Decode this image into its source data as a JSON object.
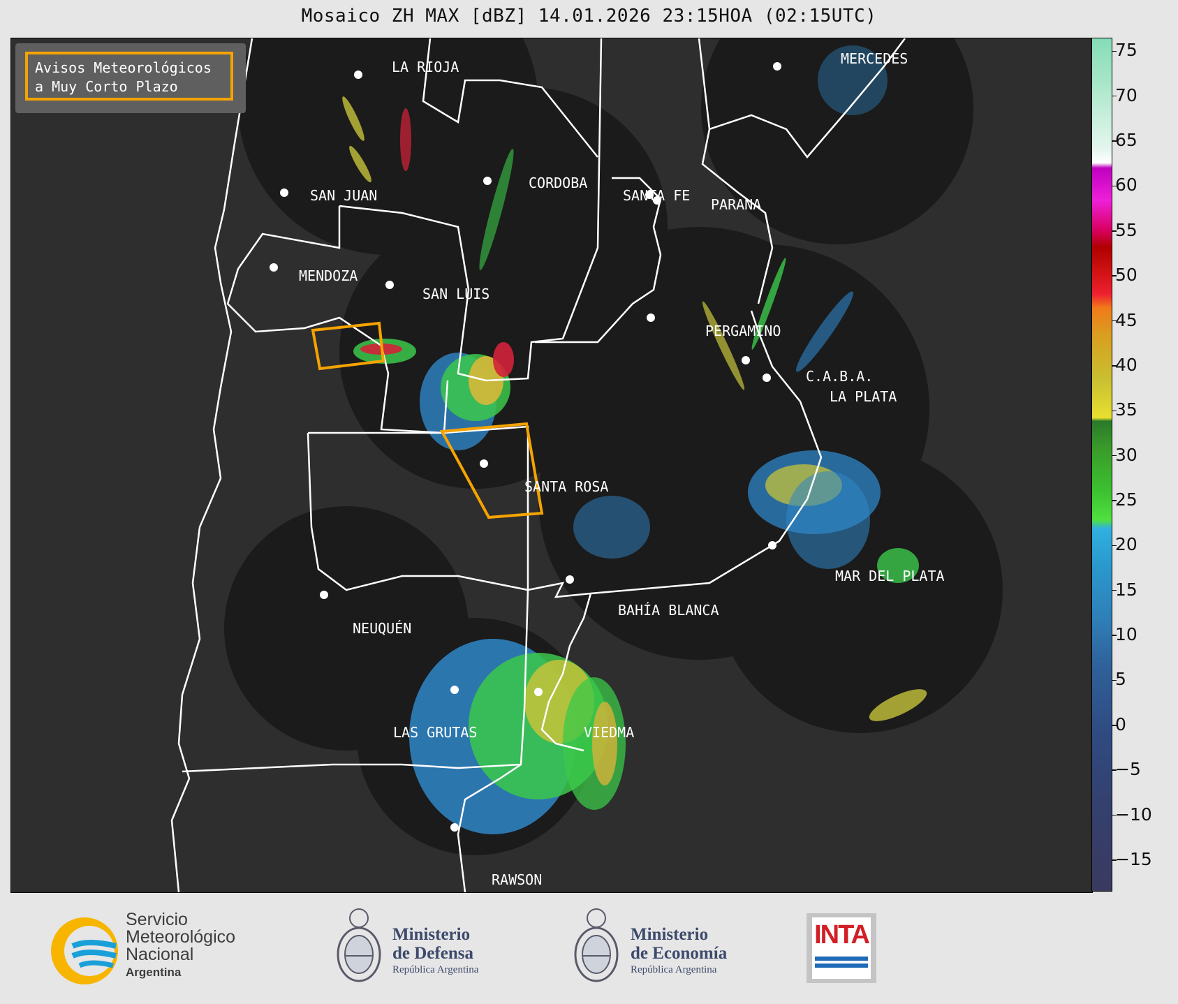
{
  "title": "Mosaico ZH MAX [dBZ] 14.01.2026 23:15HOA (02:15UTC)",
  "warning_box": {
    "line1": "Avisos Meteorológicos",
    "line2": "a Muy Corto Plazo",
    "color": "#f5a300"
  },
  "cities": [
    {
      "id": "la-rioja",
      "name": "LA RIOJA"
    },
    {
      "id": "mercedes",
      "name": "MERCEDES"
    },
    {
      "id": "san-juan",
      "name": "SAN JUAN"
    },
    {
      "id": "cordoba",
      "name": "CORDOBA"
    },
    {
      "id": "santa-fe",
      "name": "SANTA FE"
    },
    {
      "id": "parana",
      "name": "PARANA"
    },
    {
      "id": "mendoza",
      "name": "MENDOZA"
    },
    {
      "id": "san-luis",
      "name": "SAN LUIS"
    },
    {
      "id": "pergamino",
      "name": "PERGAMINO"
    },
    {
      "id": "caba",
      "name": "C.A.B.A."
    },
    {
      "id": "la-plata",
      "name": "LA PLATA"
    },
    {
      "id": "santa-rosa",
      "name": "SANTA ROSA"
    },
    {
      "id": "mar-del-plata",
      "name": "MAR DEL PLATA"
    },
    {
      "id": "bahia-blanca",
      "name": "BAHÍA BLANCA"
    },
    {
      "id": "neuquen",
      "name": "NEUQUÉN"
    },
    {
      "id": "las-grutas",
      "name": "LAS GRUTAS"
    },
    {
      "id": "viedma",
      "name": "VIEDMA"
    },
    {
      "id": "rawson",
      "name": "RAWSON"
    }
  ],
  "colorbar": {
    "ticks": [
      "75",
      "70",
      "65",
      "60",
      "55",
      "50",
      "45",
      "40",
      "35",
      "30",
      "25",
      "20",
      "15",
      "10",
      "5",
      "0",
      "−5",
      "−10",
      "−15"
    ],
    "min": -18.5,
    "max": 76.5
  },
  "logos": {
    "smn": {
      "line1": "Servicio",
      "line2": "Meteorológico",
      "line3": "Nacional",
      "line4": "Argentina"
    },
    "defensa": {
      "line1": "Ministerio",
      "line2": "de Defensa",
      "line3": "República Argentina"
    },
    "economia": {
      "line1": "Ministerio",
      "line2": "de Economía",
      "line3": "República Argentina"
    },
    "inta": {
      "text": "INTA"
    }
  }
}
